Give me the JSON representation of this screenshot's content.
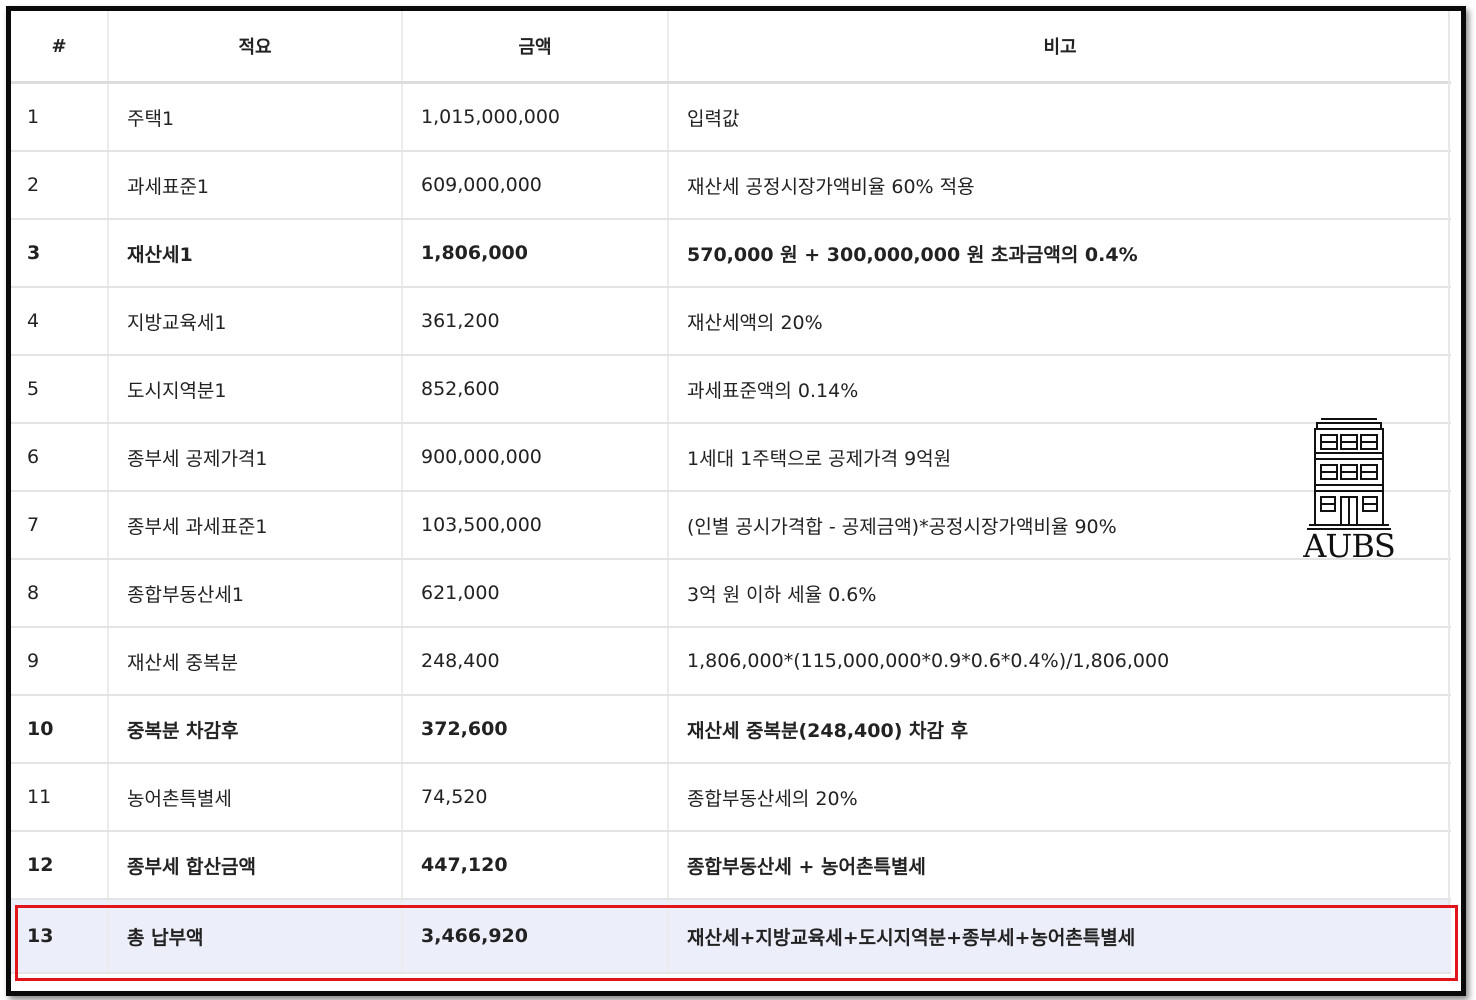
{
  "table": {
    "headers": {
      "num": "#",
      "desc": "적요",
      "amount": "금액",
      "note": "비고"
    },
    "rows": [
      {
        "num": "1",
        "desc": "주택1",
        "amount": "1,015,000,000",
        "note": "입력값",
        "bold": false
      },
      {
        "num": "2",
        "desc": "과세표준1",
        "amount": "609,000,000",
        "note": "재산세 공정시장가액비율 60% 적용",
        "bold": false
      },
      {
        "num": "3",
        "desc": "재산세1",
        "amount": "1,806,000",
        "note": "570,000 원 + 300,000,000 원 초과금액의 0.4%",
        "bold": true
      },
      {
        "num": "4",
        "desc": "지방교육세1",
        "amount": "361,200",
        "note": "재산세액의 20%",
        "bold": false
      },
      {
        "num": "5",
        "desc": "도시지역분1",
        "amount": "852,600",
        "note": "과세표준액의 0.14%",
        "bold": false
      },
      {
        "num": "6",
        "desc": "종부세 공제가격1",
        "amount": "900,000,000",
        "note": "1세대 1주택으로 공제가격 9억원",
        "bold": false
      },
      {
        "num": "7",
        "desc": "종부세 과세표준1",
        "amount": "103,500,000",
        "note": "(인별 공시가격합 - 공제금액)*공정시장가액비율 90%",
        "bold": false
      },
      {
        "num": "8",
        "desc": "종합부동산세1",
        "amount": "621,000",
        "note": "3억 원 이하 세율 0.6%",
        "bold": false
      },
      {
        "num": "9",
        "desc": "재산세 중복분",
        "amount": "248,400",
        "note": "1,806,000*(115,000,000*0.9*0.6*0.4%)/1,806,000",
        "bold": false
      },
      {
        "num": "10",
        "desc": "중복분 차감후",
        "amount": "372,600",
        "note": "재산세 중복분(248,400) 차감 후",
        "bold": true
      },
      {
        "num": "11",
        "desc": "농어촌특별세",
        "amount": "74,520",
        "note": "종합부동산세의 20%",
        "bold": false
      },
      {
        "num": "12",
        "desc": "종부세 합산금액",
        "amount": "447,120",
        "note": "종합부동산세 + 농어촌특별세",
        "bold": true
      },
      {
        "num": "13",
        "desc": "총 납부액",
        "amount": "3,466,920",
        "note": "재산세+지방교육세+도시지역분+종부세+농어촌특별세",
        "bold": true
      }
    ]
  },
  "watermark": {
    "text": "AUBS",
    "icon": "building-icon"
  },
  "colors": {
    "highlight_border": "#e0141a",
    "total_row_bg": "#eceef9",
    "frame_border": "#0a0a0a"
  }
}
